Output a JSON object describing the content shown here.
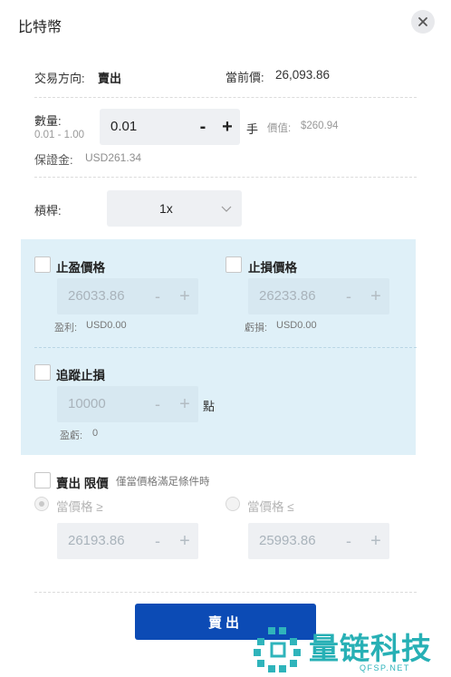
{
  "header": {
    "title": "比特幣"
  },
  "order": {
    "direction_label": "交易方向:",
    "direction_value": "賣出",
    "current_price_label": "當前價:",
    "current_price_value": "26,093.86"
  },
  "quantity": {
    "label": "數量:",
    "range": "0.01 - 1.00",
    "value": "0.01",
    "minus": "-",
    "plus": "+",
    "unit": "手",
    "worth_label": "價值:",
    "worth_value": "$260.94",
    "margin_label": "保證金:",
    "margin_value": "USD261.34"
  },
  "leverage": {
    "label": "槓桿:",
    "value": "1x"
  },
  "take_profit": {
    "label": "止盈價格",
    "value": "26033.86",
    "minus": "-",
    "plus": "+",
    "result_label": "盈利:",
    "result_value": "USD0.00"
  },
  "stop_loss": {
    "label": "止損價格",
    "value": "26233.86",
    "minus": "-",
    "plus": "+",
    "result_label": "虧損:",
    "result_value": "USD0.00"
  },
  "trailing_stop": {
    "label": "追蹤止損",
    "value": "10000",
    "minus": "-",
    "plus": "+",
    "unit": "點",
    "result_label": "盈虧:",
    "result_value": "0"
  },
  "limit_order": {
    "label": "賣出 限價",
    "hint": "僅當價格滿足條件時",
    "option_gte": "當價格 ≥",
    "option_lte": "當價格 ≤",
    "value_gte": "26193.86",
    "value_lte": "25993.86",
    "minus": "-",
    "plus": "+"
  },
  "submit": {
    "label": "賣出"
  },
  "watermark": {
    "text": "量链科技",
    "sub": "QFSP.NET"
  },
  "colors": {
    "accent": "#0c4bb5",
    "panel": "#dff0f8",
    "watermark": "#27b0b5"
  }
}
